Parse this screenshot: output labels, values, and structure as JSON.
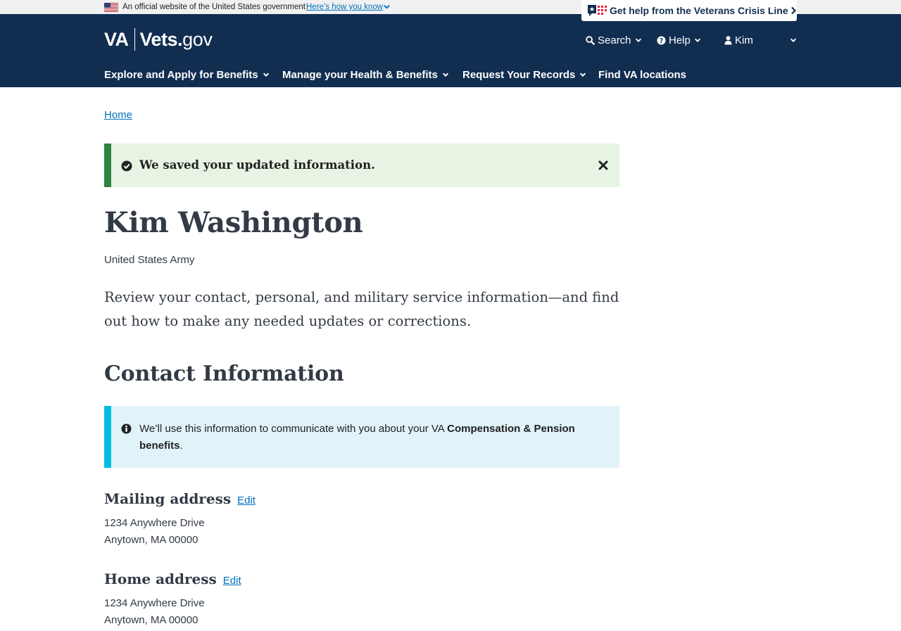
{
  "gov_banner": {
    "official_text": "An official website of the United States government",
    "how_you_know": "Here’s how you know"
  },
  "header": {
    "logo": {
      "va": "VA",
      "vets": "Vets.",
      "gov": "gov"
    },
    "crisis_line": "Get help from the Veterans Crisis Line",
    "utility": {
      "search": "Search",
      "help": "Help",
      "user": "Kim"
    },
    "nav": {
      "explore": "Explore and Apply for Benefits",
      "manage": "Manage your Health & Benefits",
      "records": "Request Your Records",
      "find": "Find VA locations"
    },
    "colors": {
      "background": "#112e51",
      "crisis_text": "#112e51"
    }
  },
  "breadcrumb": {
    "home": "Home"
  },
  "success_alert": {
    "message": "We saved your updated information.",
    "icon": "check-circle-icon",
    "close_icon": "close-icon"
  },
  "profile": {
    "name": "Kim Washington",
    "branch": "United States Army",
    "intro": "Review your contact, personal, and military service information—and find out how to make any needed updates or corrections."
  },
  "contact": {
    "heading": "Contact Information",
    "info_alert": {
      "before": "We’ll use this information to communicate with you about your VA ",
      "bold": "Compensation & Pension benefits",
      "after": "."
    },
    "mailing": {
      "title": "Mailing address",
      "edit": "Edit",
      "line1": "1234 Anywhere Drive",
      "line2": "Anytown, MA 00000"
    },
    "home": {
      "title": "Home address",
      "edit": "Edit",
      "line1": "1234 Anywhere Drive",
      "line2": "Anytown, MA 00000"
    }
  },
  "colors": {
    "link": "#0071bb",
    "success_bg": "#e7f4e4",
    "success_border": "#2e8540",
    "info_bg": "#e1f3f8",
    "info_border": "#00bde3",
    "heading": "#323a45"
  }
}
